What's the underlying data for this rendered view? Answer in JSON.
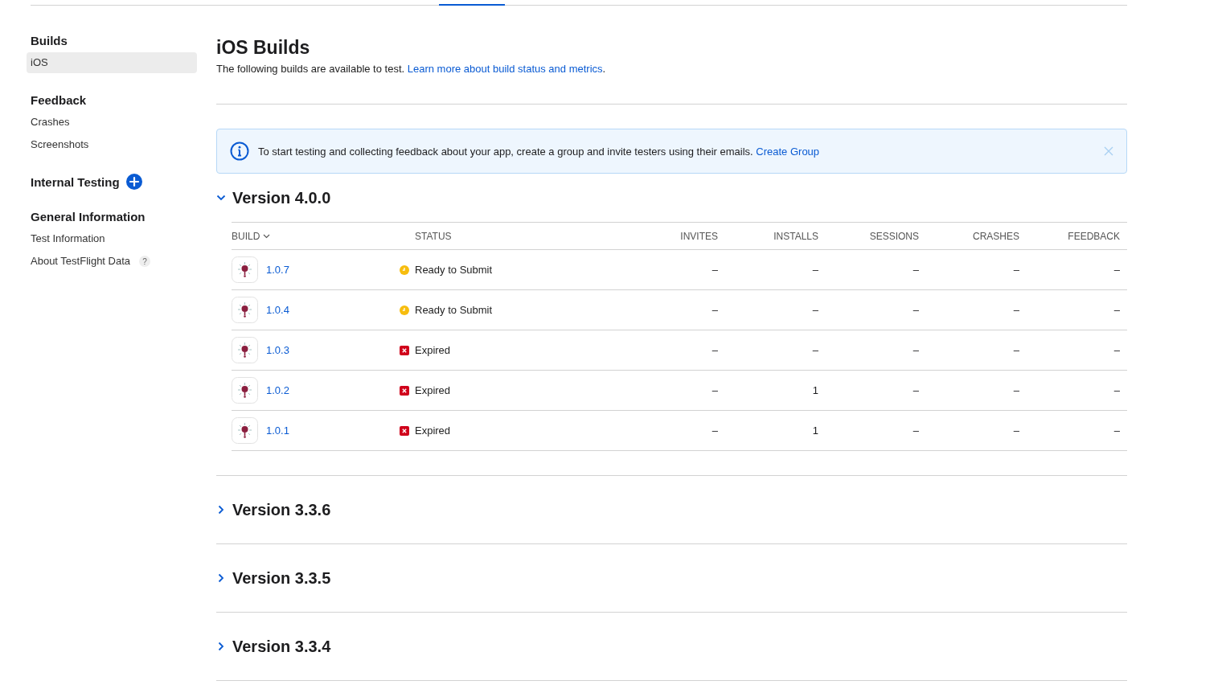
{
  "sidebar": {
    "sections": [
      {
        "title": "Builds",
        "items": [
          {
            "label": "iOS",
            "selected": true
          }
        ]
      },
      {
        "title": "Feedback",
        "items": [
          {
            "label": "Crashes",
            "selected": false
          },
          {
            "label": "Screenshots",
            "selected": false
          }
        ]
      },
      {
        "title": "Internal Testing",
        "add_button": true
      },
      {
        "title": "General Information",
        "items": [
          {
            "label": "Test Information",
            "selected": false
          },
          {
            "label": "About TestFlight Data",
            "selected": false,
            "help": "?"
          }
        ]
      }
    ]
  },
  "page": {
    "title": "iOS Builds",
    "subtitle": "The following builds are available to test.",
    "subtitle_link": "Learn more about build status and metrics",
    "subtitle_end": "."
  },
  "banner": {
    "text": "To start testing and collecting feedback about your app, create a group and invite testers using their emails.",
    "link": "Create Group"
  },
  "table": {
    "columns": [
      "BUILD",
      "STATUS",
      "INVITES",
      "INSTALLS",
      "SESSIONS",
      "CRASHES",
      "FEEDBACK"
    ]
  },
  "versions": [
    {
      "title": "Version 4.0.0",
      "expanded": true,
      "builds": [
        {
          "build": "1.0.7",
          "kind": "ready",
          "status": "Ready to Submit",
          "invites": "–",
          "installs": "–",
          "sessions": "–",
          "crashes": "–",
          "feedback": "–"
        },
        {
          "build": "1.0.4",
          "kind": "ready",
          "status": "Ready to Submit",
          "invites": "–",
          "installs": "–",
          "sessions": "–",
          "crashes": "–",
          "feedback": "–"
        },
        {
          "build": "1.0.3",
          "kind": "expired",
          "status": "Expired",
          "invites": "–",
          "installs": "–",
          "sessions": "–",
          "crashes": "–",
          "feedback": "–"
        },
        {
          "build": "1.0.2",
          "kind": "expired",
          "status": "Expired",
          "invites": "–",
          "installs": "1",
          "sessions": "–",
          "crashes": "–",
          "feedback": "–"
        },
        {
          "build": "1.0.1",
          "kind": "expired",
          "status": "Expired",
          "invites": "–",
          "installs": "1",
          "sessions": "–",
          "crashes": "–",
          "feedback": "–"
        }
      ]
    },
    {
      "title": "Version 3.3.6",
      "expanded": false
    },
    {
      "title": "Version 3.3.5",
      "expanded": false
    },
    {
      "title": "Version 3.3.4",
      "expanded": false
    }
  ]
}
